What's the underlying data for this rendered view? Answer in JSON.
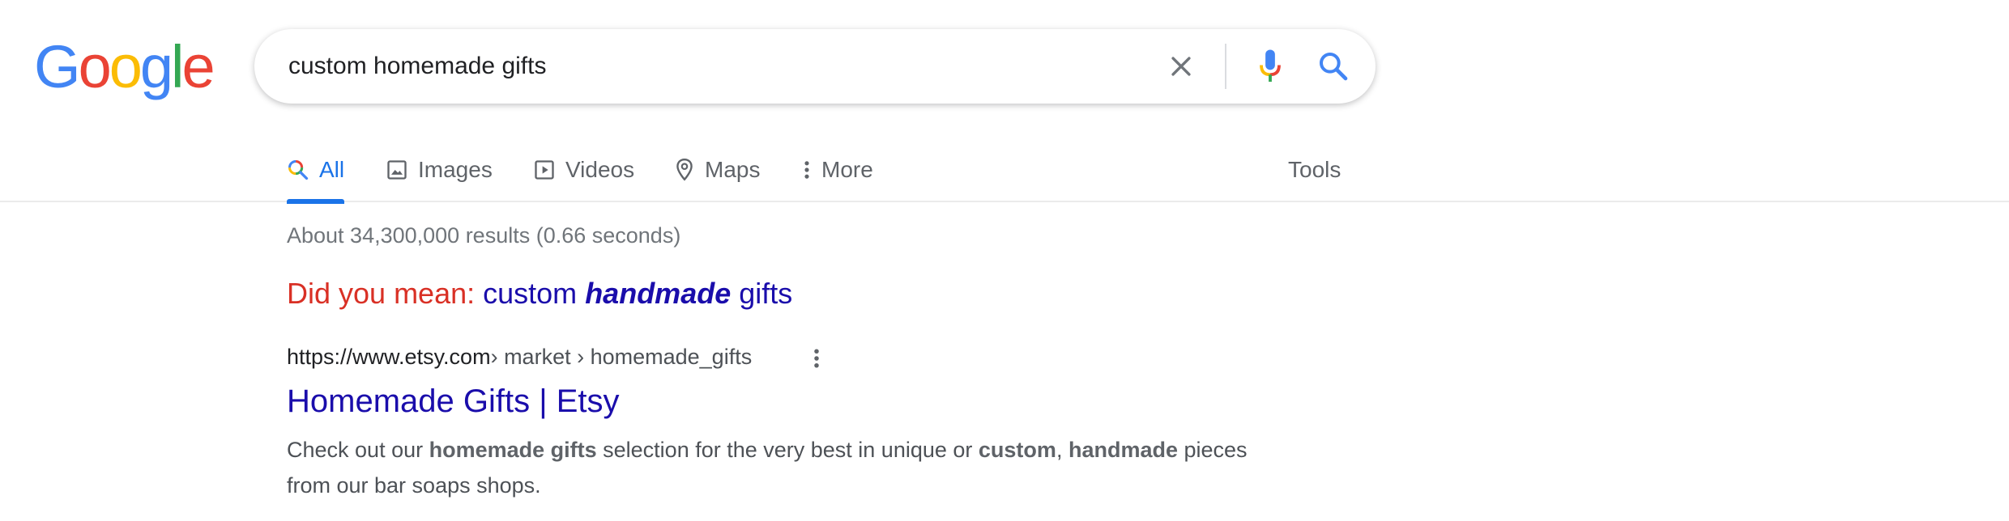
{
  "logo": {
    "letters": [
      "G",
      "o",
      "o",
      "g",
      "l",
      "e"
    ],
    "colors": [
      "#4285F4",
      "#EA4335",
      "#FBBC05",
      "#4285F4",
      "#34A853",
      "#EA4335"
    ]
  },
  "search": {
    "query": "custom homemade gifts",
    "clear_icon": "close-icon",
    "mic_icon": "microphone-icon",
    "search_icon": "search-icon"
  },
  "tabs": [
    {
      "label": "All",
      "icon": "search-icon",
      "active": true
    },
    {
      "label": "Images",
      "icon": "image-icon"
    },
    {
      "label": "Videos",
      "icon": "play-icon"
    },
    {
      "label": "Maps",
      "icon": "map-pin-icon"
    },
    {
      "label": "More",
      "icon": "more-vert-icon"
    }
  ],
  "tools_label": "Tools",
  "stats": "About 34,300,000 results (0.66 seconds)",
  "spelling": {
    "prefix": "Did you mean:",
    "part1": "custom ",
    "bold": "handmade",
    "part2": " gifts"
  },
  "result": {
    "domain": "https://www.etsy.com",
    "path": " › market › homemade_gifts",
    "menu_icon": "more-vert-icon",
    "title": "Homemade Gifts | Etsy",
    "snippet": {
      "t1": "Check out our ",
      "b1": "homemade gifts",
      "t2": " selection for the very best in unique or ",
      "b2": "custom",
      "t3": ", ",
      "b3": "handmade",
      "t4": " pieces from our bar soaps shops."
    }
  },
  "colors": {
    "accent": "#1a73e8",
    "link": "#1a0dab",
    "spell_red": "#d93025"
  }
}
